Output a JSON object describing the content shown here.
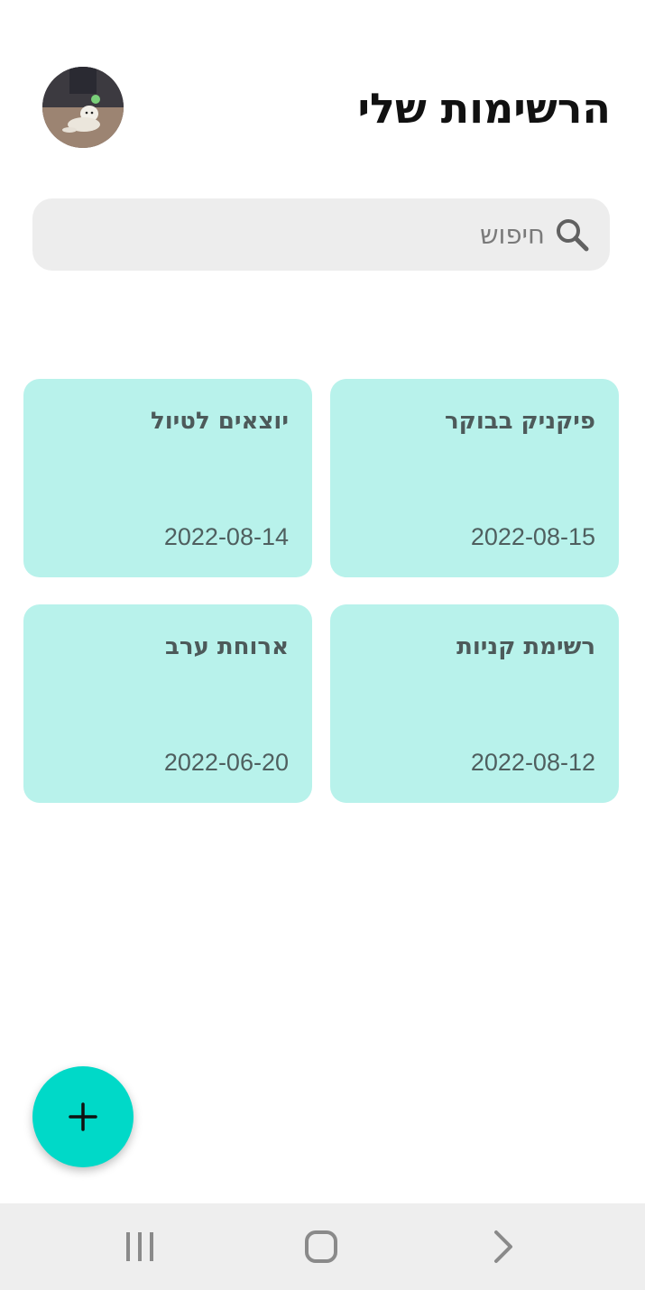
{
  "header": {
    "title": "הרשימות שלי"
  },
  "search": {
    "placeholder": "חיפוש",
    "value": ""
  },
  "notes": [
    {
      "title": "פיקניק בבוקר",
      "date": "2022-08-15"
    },
    {
      "title": "יוצאים לטיול",
      "date": "2022-08-14"
    },
    {
      "title": "רשימת קניות",
      "date": "2022-08-12"
    },
    {
      "title": "ארוחת ערב",
      "date": "2022-06-20"
    }
  ],
  "icons": {
    "avatar": "profile-photo-dog",
    "search": "search-icon",
    "fab": "plus-icon",
    "nav_recents": "recents-icon",
    "nav_home": "home-icon",
    "nav_back": "back-icon"
  },
  "colors": {
    "card_background": "#b8f2eb",
    "fab_background": "#00d9c8",
    "search_background": "#ededed",
    "nav_background": "#eeeeee"
  }
}
